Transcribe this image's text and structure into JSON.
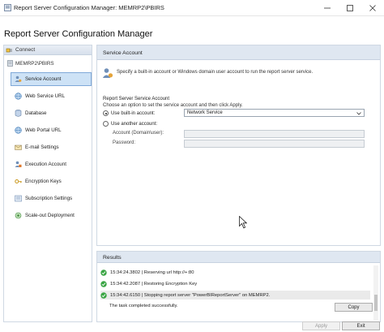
{
  "window": {
    "title": "Report Server Configuration Manager: MEMRP2\\PBIRS"
  },
  "header": {
    "app_title": "Report Server Configuration Manager"
  },
  "nav": {
    "connect_label": "Connect",
    "server_label": "MEMRP2\\PBIRS",
    "items": [
      {
        "label": "Service Account",
        "icon": "service-account-icon"
      },
      {
        "label": "Web Service URL",
        "icon": "globe-icon"
      },
      {
        "label": "Database",
        "icon": "database-icon"
      },
      {
        "label": "Web Portal URL",
        "icon": "globe-icon"
      },
      {
        "label": "E-mail Settings",
        "icon": "email-icon"
      },
      {
        "label": "Execution Account",
        "icon": "execution-account-icon"
      },
      {
        "label": "Encryption Keys",
        "icon": "key-icon"
      },
      {
        "label": "Subscription Settings",
        "icon": "subscription-icon"
      },
      {
        "label": "Scale-out Deployment",
        "icon": "scale-out-icon"
      }
    ]
  },
  "service_account": {
    "header": "Service Account",
    "description": "Specify a built-in account or Windows domain user account to run the report server service.",
    "group_title": "Report Server Service Account",
    "group_sub": "Choose an option to set the service account and then click Apply.",
    "builtin_label": "Use built-in account:",
    "builtin_value": "Network Service",
    "another_label": "Use another account:",
    "account_label": "Account (Domain\\user):",
    "password_label": "Password:"
  },
  "results": {
    "header": "Results",
    "rows": [
      "15:34:24.3802 | Reserving url http://+:80",
      "15:34:42.2087 | Restoring Encryption Key",
      "15:34:42.6150 | Stopping report server \"PowerBIReportServer\" on MEMRP2."
    ],
    "note": "The task completed successfully.",
    "copy_label": "Copy"
  },
  "footer": {
    "apply_label": "Apply",
    "exit_label": "Exit"
  },
  "colors": {
    "selected_bg": "#cde2f6",
    "header_bg": "#dfe7f1",
    "success": "#3aa544"
  }
}
